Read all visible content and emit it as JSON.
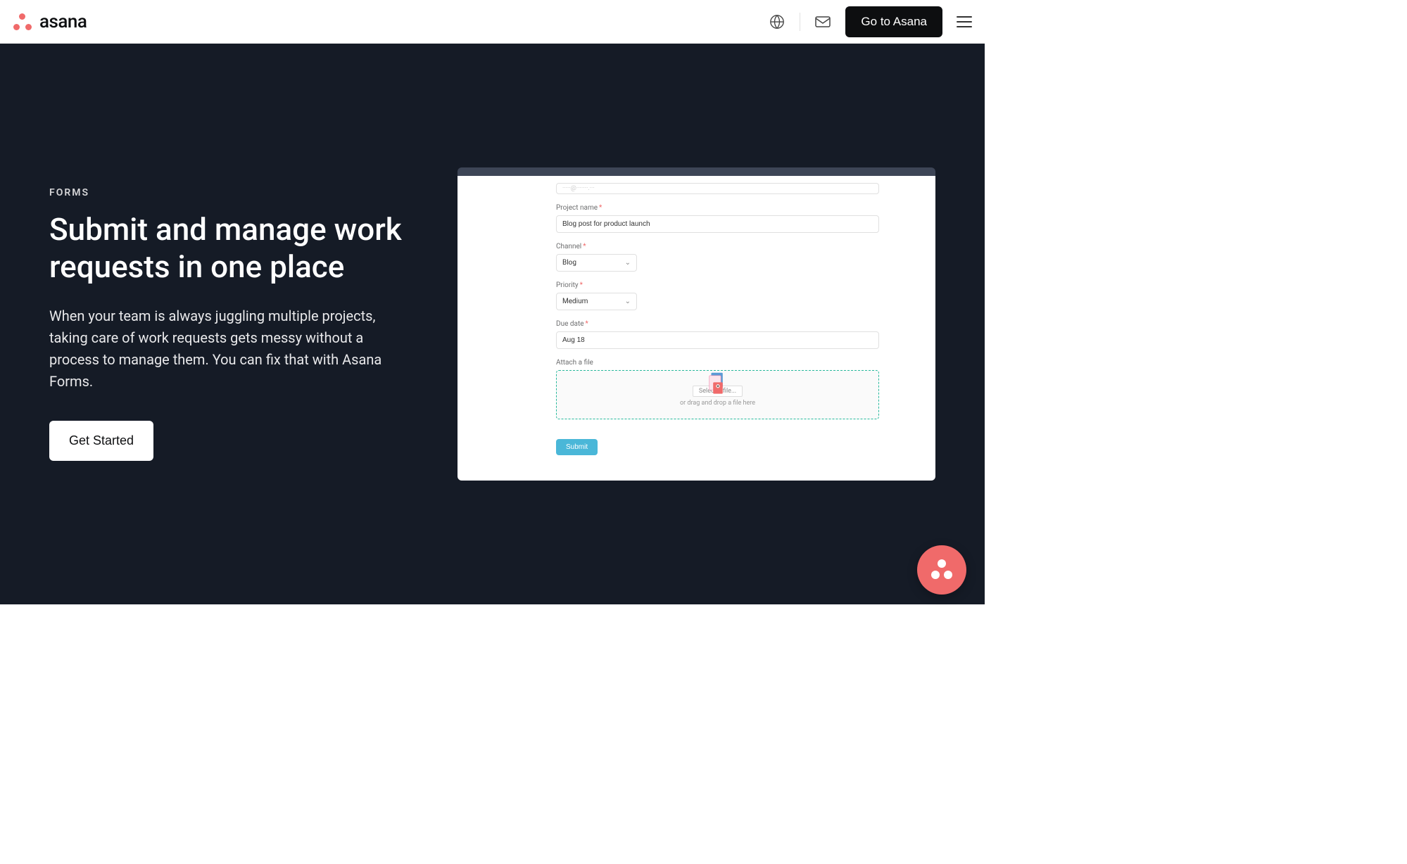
{
  "header": {
    "brand": "asana",
    "cta": "Go to Asana"
  },
  "hero": {
    "eyebrow": "FORMS",
    "title": "Submit and manage work requests in one place",
    "description": "When your team is always juggling multiple projects, taking care of work requests gets messy without a process to manage them. You can fix that with Asana Forms.",
    "cta": "Get Started"
  },
  "form": {
    "fields": {
      "project_name": {
        "label": "Project name",
        "value": "Blog post for product launch",
        "required": true
      },
      "channel": {
        "label": "Channel",
        "value": "Blog",
        "required": true
      },
      "priority": {
        "label": "Priority",
        "value": "Medium",
        "required": true
      },
      "due_date": {
        "label": "Due date",
        "value": "Aug 18",
        "required": true
      },
      "attach": {
        "label": "Attach a file",
        "select_text": "Select a file...",
        "hint": "or drag and drop a file here"
      }
    },
    "submit": "Submit"
  }
}
